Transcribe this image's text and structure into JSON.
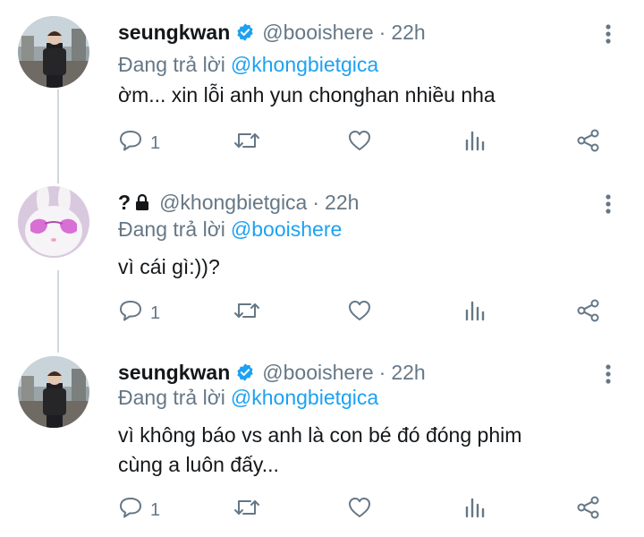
{
  "colors": {
    "text": "#14171a",
    "secondary": "#657786",
    "link": "#1da1f2",
    "verified": "#1da1f2",
    "thread_line": "#cfd9de",
    "icon": "#657786"
  },
  "tweets": [
    {
      "name": "seungkwan",
      "verified": true,
      "handle": "@booishere",
      "dot": "·",
      "time": "22h",
      "reply_label": "Đang trả lời",
      "reply_mention": "@khongbietgica",
      "text_lines": [
        "ờm...  xin lỗi anh yun chonghan nhiều nha"
      ],
      "reply_count": "1"
    },
    {
      "name": "?",
      "locked": true,
      "handle": "@khongbietgica",
      "dot": "·",
      "time": "22h",
      "reply_label": "Đang trả lời",
      "reply_mention": "@booishere",
      "text_lines": [
        "vì cái gì:))?"
      ],
      "reply_count": "1"
    },
    {
      "name": "seungkwan",
      "verified": true,
      "handle": "@booishere",
      "dot": "·",
      "time": "22h",
      "reply_label": "Đang trả lời",
      "reply_mention": "@khongbietgica",
      "text_lines": [
        "vì không báo vs anh là con bé đó đóng phim",
        "cùng a luôn đấy..."
      ],
      "reply_count": "1"
    }
  ],
  "icons": {
    "reply": "reply-icon",
    "retweet": "retweet-icon",
    "like": "heart-icon",
    "analytics": "analytics-icon",
    "share": "share-icon",
    "more": "more-vertical-icon",
    "verified": "verified-badge-icon",
    "lock": "lock-icon"
  }
}
